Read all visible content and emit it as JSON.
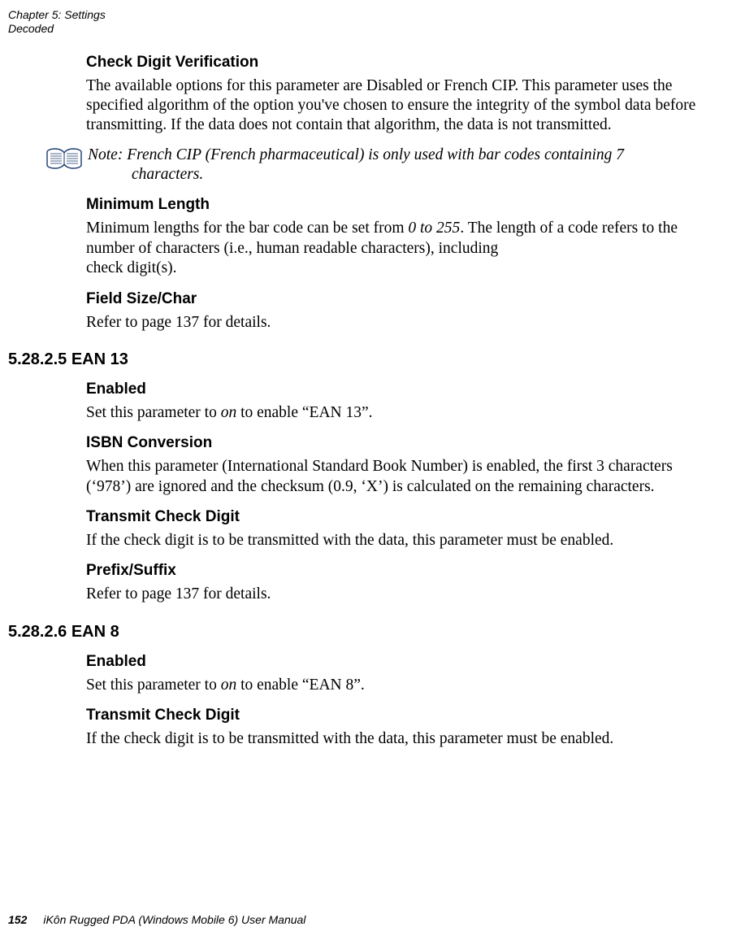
{
  "header": {
    "line1": "Chapter 5: Settings",
    "line2": "Decoded"
  },
  "sections": {
    "check_digit_verification": {
      "title": "Check Digit Verification",
      "body": "The available options for this parameter are Disabled or French CIP. This parameter uses the specified algorithm of the option you've chosen to ensure the integrity of the symbol data before transmitting. If the data does not contain that algorithm, the data is not transmitted."
    },
    "note": {
      "label": "Note:",
      "body_line1": "French CIP (French pharmaceutical) is only used with bar codes containing 7",
      "body_line2": "characters."
    },
    "minimum_length": {
      "title": "Minimum Length",
      "body_pre": "Minimum lengths for the bar code can be set from ",
      "body_em": "0 to 255",
      "body_post": ". The length of a code refers to the number of characters (i.e., human readable characters), including",
      "body_last": "check digit(s)."
    },
    "field_size_char": {
      "title": "Field Size/Char",
      "body": "Refer to page 137 for details."
    },
    "ean13": {
      "heading": "5.28.2.5 EAN 13",
      "enabled": {
        "title": "Enabled",
        "body_pre": "Set this parameter to ",
        "body_em": "on",
        "body_post": " to enable “EAN 13”."
      },
      "isbn": {
        "title": "ISBN Conversion",
        "body": "When this parameter (International Standard Book Number) is enabled, the first 3 characters (‘978’) are ignored and the checksum (0.9, ‘X’) is calculated on the remaining characters."
      },
      "transmit": {
        "title": "Transmit Check Digit",
        "body": "If the check digit is to be transmitted with the data, this parameter must be enabled."
      },
      "prefix": {
        "title": "Prefix/Suffix",
        "body": "Refer to page 137 for details."
      }
    },
    "ean8": {
      "heading": "5.28.2.6 EAN 8",
      "enabled": {
        "title": "Enabled",
        "body_pre": "Set this parameter to ",
        "body_em": "on",
        "body_post": " to enable “EAN 8”."
      },
      "transmit": {
        "title": "Transmit Check Digit",
        "body": "If the check digit is to be transmitted with the data, this parameter must be enabled."
      }
    }
  },
  "footer": {
    "page": "152",
    "title": "iKôn Rugged PDA (Windows Mobile 6) User Manual"
  }
}
